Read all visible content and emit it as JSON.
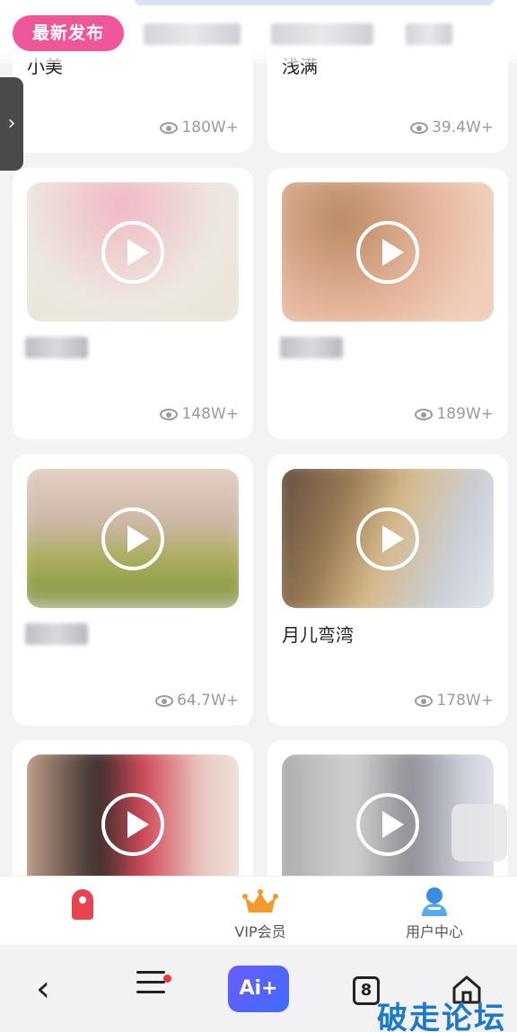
{
  "tabs": {
    "active_label": "最新发布"
  },
  "cards": [
    {
      "title": "小美",
      "views": "180W+"
    },
    {
      "title": "浅满",
      "views": "39.4W+"
    },
    {
      "title": "",
      "views": "148W+"
    },
    {
      "title": "",
      "views": "189W+"
    },
    {
      "title": "",
      "views": "64.7W+"
    },
    {
      "title": "月儿弯湾",
      "views": "178W+"
    }
  ],
  "bottom_nav": {
    "home_label": "",
    "vip_label": "VIP会员",
    "user_label": "用户中心"
  },
  "system_bar": {
    "ai_label": "Ai+",
    "tab_count": "8"
  },
  "watermark": "破走论坛",
  "colors": {
    "accent": "#f0569a",
    "ai_button": "#5a63ff",
    "rocket": "#e8444f",
    "crown": "#f29a2e",
    "user": "#3b8de0",
    "watermark": "#1e78c8"
  }
}
